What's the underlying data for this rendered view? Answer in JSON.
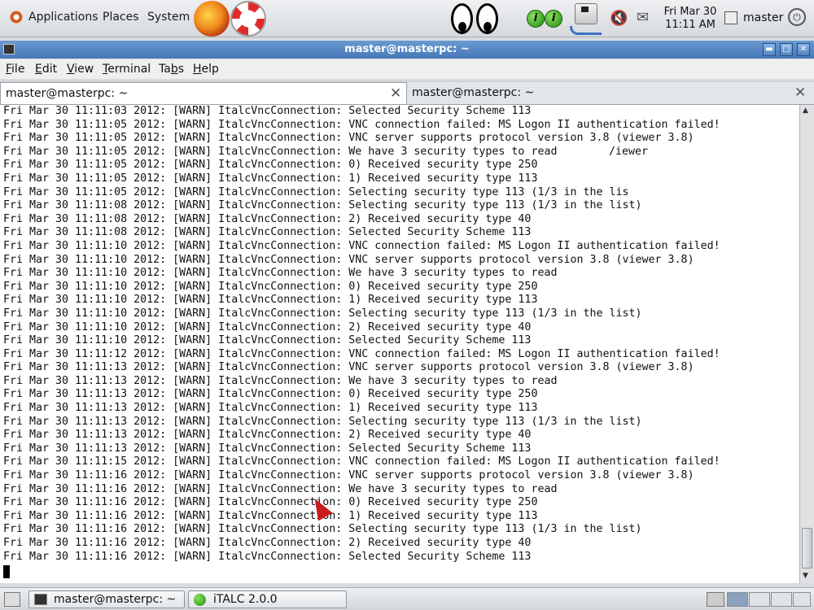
{
  "top_panel": {
    "menus": [
      "Applications",
      "Places",
      "System"
    ],
    "clock": {
      "date": "Fri Mar 30",
      "time": "11:11 AM"
    },
    "user": "master",
    "green_i": "i"
  },
  "window": {
    "title": "master@masterpc: ~",
    "menu": [
      "File",
      "Edit",
      "View",
      "Terminal",
      "Tabs",
      "Help"
    ],
    "menu_mnemonics": [
      "F",
      "E",
      "V",
      "T",
      "b",
      "H"
    ],
    "tabs": [
      {
        "label": "master@masterpc: ~",
        "active": true
      },
      {
        "label": "master@masterpc: ~",
        "active": false
      }
    ]
  },
  "terminal": {
    "lines": [
      "Fri Mar 30 11:11:03 2012: [WARN] ItalcVncConnection: Selected Security Scheme 113",
      "Fri Mar 30 11:11:05 2012: [WARN] ItalcVncConnection: VNC connection failed: MS Logon II authentication failed!",
      "Fri Mar 30 11:11:05 2012: [WARN] ItalcVncConnection: VNC server supports protocol version 3.8 (viewer 3.8)",
      "Fri Mar 30 11:11:05 2012: [WARN] ItalcVncConnection: We have 3 security types to read",
      "Fri Mar 30 11:11:05 2012: [WARN] ItalcVncConnection: 0) Received security type 250",
      "Fri Mar 30 11:11:05 2012: [WARN] ItalcVncConnection: 1) Received security type 113",
      "Fri Mar 30 11:11:05 2012: [WARN] ItalcVncConnection: Selecting security type 113 (1/3 in the lis",
      "Fri Mar 30 11:11:08 2012: [WARN] ItalcVncConnection: Selecting security type 113 (1/3 in the list)",
      "Fri Mar 30 11:11:08 2012: [WARN] ItalcVncConnection: 2) Received security type 40",
      "Fri Mar 30 11:11:08 2012: [WARN] ItalcVncConnection: Selected Security Scheme 113",
      "Fri Mar 30 11:11:10 2012: [WARN] ItalcVncConnection: VNC connection failed: MS Logon II authentication failed!",
      "Fri Mar 30 11:11:10 2012: [WARN] ItalcVncConnection: VNC server supports protocol version 3.8 (viewer 3.8)",
      "Fri Mar 30 11:11:10 2012: [WARN] ItalcVncConnection: We have 3 security types to read",
      "Fri Mar 30 11:11:10 2012: [WARN] ItalcVncConnection: 0) Received security type 250",
      "Fri Mar 30 11:11:10 2012: [WARN] ItalcVncConnection: 1) Received security type 113",
      "Fri Mar 30 11:11:10 2012: [WARN] ItalcVncConnection: Selecting security type 113 (1/3 in the list)",
      "Fri Mar 30 11:11:10 2012: [WARN] ItalcVncConnection: 2) Received security type 40",
      "Fri Mar 30 11:11:10 2012: [WARN] ItalcVncConnection: Selected Security Scheme 113",
      "Fri Mar 30 11:11:12 2012: [WARN] ItalcVncConnection: VNC connection failed: MS Logon II authentication failed!",
      "Fri Mar 30 11:11:13 2012: [WARN] ItalcVncConnection: VNC server supports protocol version 3.8 (viewer 3.8)",
      "Fri Mar 30 11:11:13 2012: [WARN] ItalcVncConnection: We have 3 security types to read",
      "Fri Mar 30 11:11:13 2012: [WARN] ItalcVncConnection: 0) Received security type 250",
      "Fri Mar 30 11:11:13 2012: [WARN] ItalcVncConnection: 1) Received security type 113",
      "Fri Mar 30 11:11:13 2012: [WARN] ItalcVncConnection: Selecting security type 113 (1/3 in the list)",
      "Fri Mar 30 11:11:13 2012: [WARN] ItalcVncConnection: 2) Received security type 40",
      "Fri Mar 30 11:11:13 2012: [WARN] ItalcVncConnection: Selected Security Scheme 113",
      "Fri Mar 30 11:11:15 2012: [WARN] ItalcVncConnection: VNC connection failed: MS Logon II authentication failed!",
      "Fri Mar 30 11:11:16 2012: [WARN] ItalcVncConnection: VNC server supports protocol version 3.8 (viewer 3.8)",
      "Fri Mar 30 11:11:16 2012: [WARN] ItalcVncConnection: We have 3 security types to read",
      "Fri Mar 30 11:11:16 2012: [WARN] ItalcVncConnection: 0) Received security type 250",
      "Fri Mar 30 11:11:16 2012: [WARN] ItalcVncConnection: 1) Received security type 113",
      "Fri Mar 30 11:11:16 2012: [WARN] ItalcVncConnection: Selecting security type 113 (1/3 in the list)",
      "Fri Mar 30 11:11:16 2012: [WARN] ItalcVncConnection: 2) Received security type 40",
      "Fri Mar 30 11:11:16 2012: [WARN] ItalcVncConnection: Selected Security Scheme 113"
    ],
    "ghost_text": "/iewer 3.8)"
  },
  "taskbar": {
    "tasks": [
      {
        "label": "master@masterpc: ~",
        "icon": "terminal-icon"
      },
      {
        "label": "iTALC 2.0.0",
        "icon": "italc-icon"
      }
    ]
  },
  "colors": {
    "title_bar": "#4678b6",
    "accent_green": "#1f8a12",
    "pointer_red": "#c81b1b"
  }
}
